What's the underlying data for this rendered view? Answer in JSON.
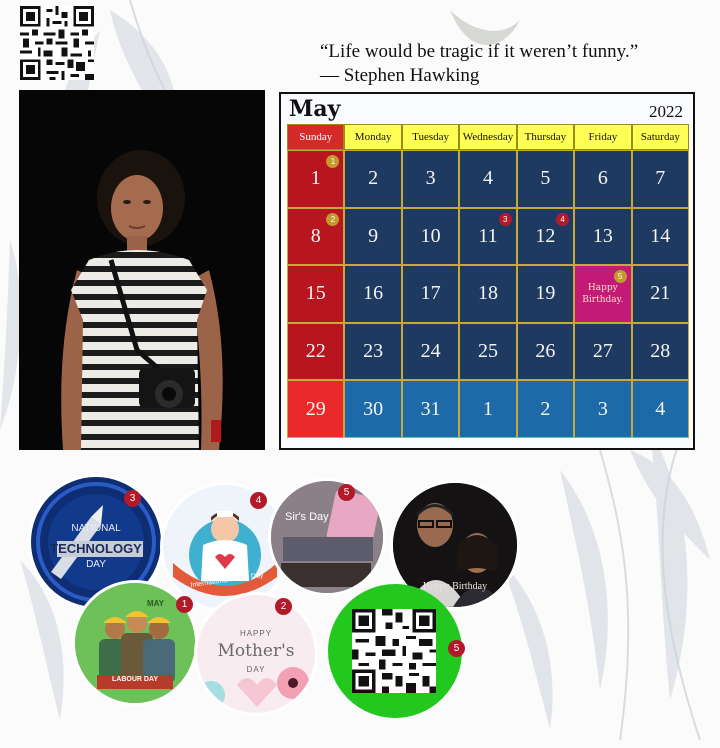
{
  "quote": {
    "text": "“Life would be tragic if it weren’t funny.”",
    "author": "— Stephen Hawking"
  },
  "calendar": {
    "month": "May",
    "year": "2022",
    "weekdays": [
      "Sunday",
      "Monday",
      "Tuesday",
      "Wednesday",
      "Thursday",
      "Friday",
      "Saturday"
    ],
    "weeks": [
      [
        "1",
        "2",
        "3",
        "4",
        "5",
        "6",
        "7"
      ],
      [
        "8",
        "9",
        "10",
        "11",
        "12",
        "13",
        "14"
      ],
      [
        "15",
        "16",
        "17",
        "18",
        "19",
        "",
        "21"
      ],
      [
        "22",
        "23",
        "24",
        "25",
        "26",
        "27",
        "28"
      ],
      [
        "29",
        "30",
        "31",
        "1",
        "2",
        "3",
        "4"
      ]
    ],
    "birthday_cell": {
      "line1": "Happy",
      "line2": "Birthday."
    },
    "markers": [
      {
        "week": 0,
        "day": 0,
        "num": "1"
      },
      {
        "week": 1,
        "day": 0,
        "num": "2"
      },
      {
        "week": 1,
        "day": 3,
        "num": "3"
      },
      {
        "week": 1,
        "day": 4,
        "num": "4"
      },
      {
        "week": 2,
        "day": 5,
        "num": "5"
      }
    ]
  },
  "events": {
    "technology_day": {
      "line1": "NATIONAL",
      "line2": "TECHNOLOGY",
      "line3": "DAY",
      "badge": "3"
    },
    "nurse_day": {
      "text": "International Nurse Day",
      "badge": "4"
    },
    "sirs_day": {
      "text": "Sir's Day",
      "badge": "5"
    },
    "birthday": {
      "text": "Happy Birthday"
    },
    "labour_day": {
      "month": "MAY",
      "banner": "LABOUR DAY",
      "badge": "1"
    },
    "mothers_day": {
      "line1": "HAPPY",
      "line2": "Mother's",
      "line3": "DAY",
      "badge": "2"
    },
    "qr": {
      "badge": "5"
    }
  },
  "colors": {
    "calendar_weekday_header": "#ffff55",
    "sunday": "#d42a2a",
    "cell_blue": "#1f3a60",
    "qr_circle_green": "#22c81e",
    "badge_red": "#b21a2a"
  }
}
